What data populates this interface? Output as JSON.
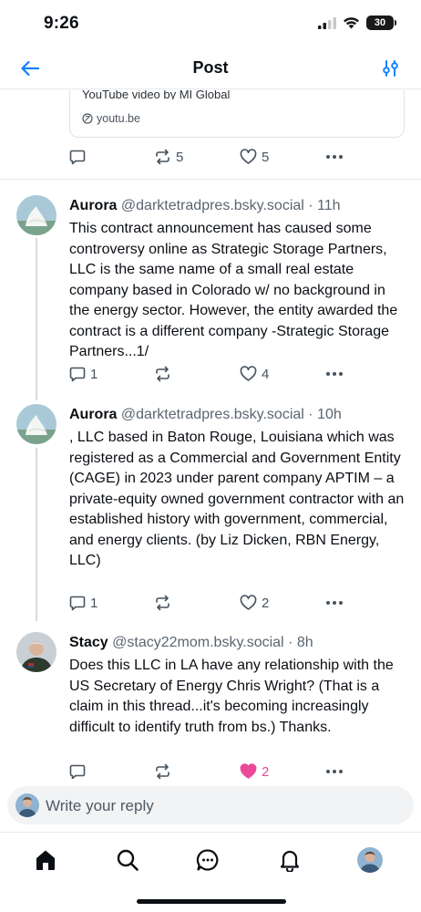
{
  "status_bar": {
    "time": "9:26",
    "battery": "30"
  },
  "header": {
    "title": "Post"
  },
  "embed": {
    "description": "YouTube video by MI Global",
    "domain": "youtu.be"
  },
  "top_actions": {
    "reply_count": "",
    "repost_count": "5",
    "like_count": "5"
  },
  "posts": [
    {
      "name": "Aurora",
      "handle": "@darktetradpres.bsky.social",
      "time": "· 11h",
      "text": "This contract announcement has caused some controversy online as Strategic Storage Partners, LLC is the same name of a small real estate company based in Colorado w/ no background in the energy sector. However, the entity awarded the contract is a different company -Strategic Storage Partners...1/",
      "reply_count": "1",
      "repost_count": "",
      "like_count": "4",
      "liked": false
    },
    {
      "name": "Aurora",
      "handle": "@darktetradpres.bsky.social",
      "time": "· 10h",
      "text": ", LLC based in Baton Rouge, Louisiana which was registered as a Commercial and Government Entity (CAGE) in 2023 under parent company APTIM – a private-equity owned government contractor with an established history with government, commercial, and energy clients. (by Liz Dicken, RBN Energy, LLC)",
      "reply_count": "1",
      "repost_count": "",
      "like_count": "2",
      "liked": false
    },
    {
      "name": "Stacy",
      "handle": "@stacy22mom.bsky.social",
      "time": "· 8h",
      "text": "Does this LLC in LA have any relationship with the US Secretary of Energy Chris Wright? (That is a claim in this thread...it's becoming increasingly difficult to identify truth from bs.) Thanks.",
      "reply_count": "",
      "repost_count": "",
      "like_count": "2",
      "liked": true
    }
  ],
  "reply_bar": {
    "placeholder": "Write your reply"
  },
  "colors": {
    "accent": "#1083fe",
    "like_active": "#ec4899",
    "secondary_text": "#5b6570",
    "thread_line": "#d4dbe2"
  },
  "icons": {
    "back": "arrow-left-icon",
    "filter": "sliders-icon",
    "reply": "speech-bubble-icon",
    "repost": "repost-arrows-icon",
    "like": "heart-icon",
    "more": "ellipsis-icon",
    "nav": [
      "home-icon",
      "search-icon",
      "chat-icon",
      "bell-icon",
      "profile-avatar"
    ]
  }
}
